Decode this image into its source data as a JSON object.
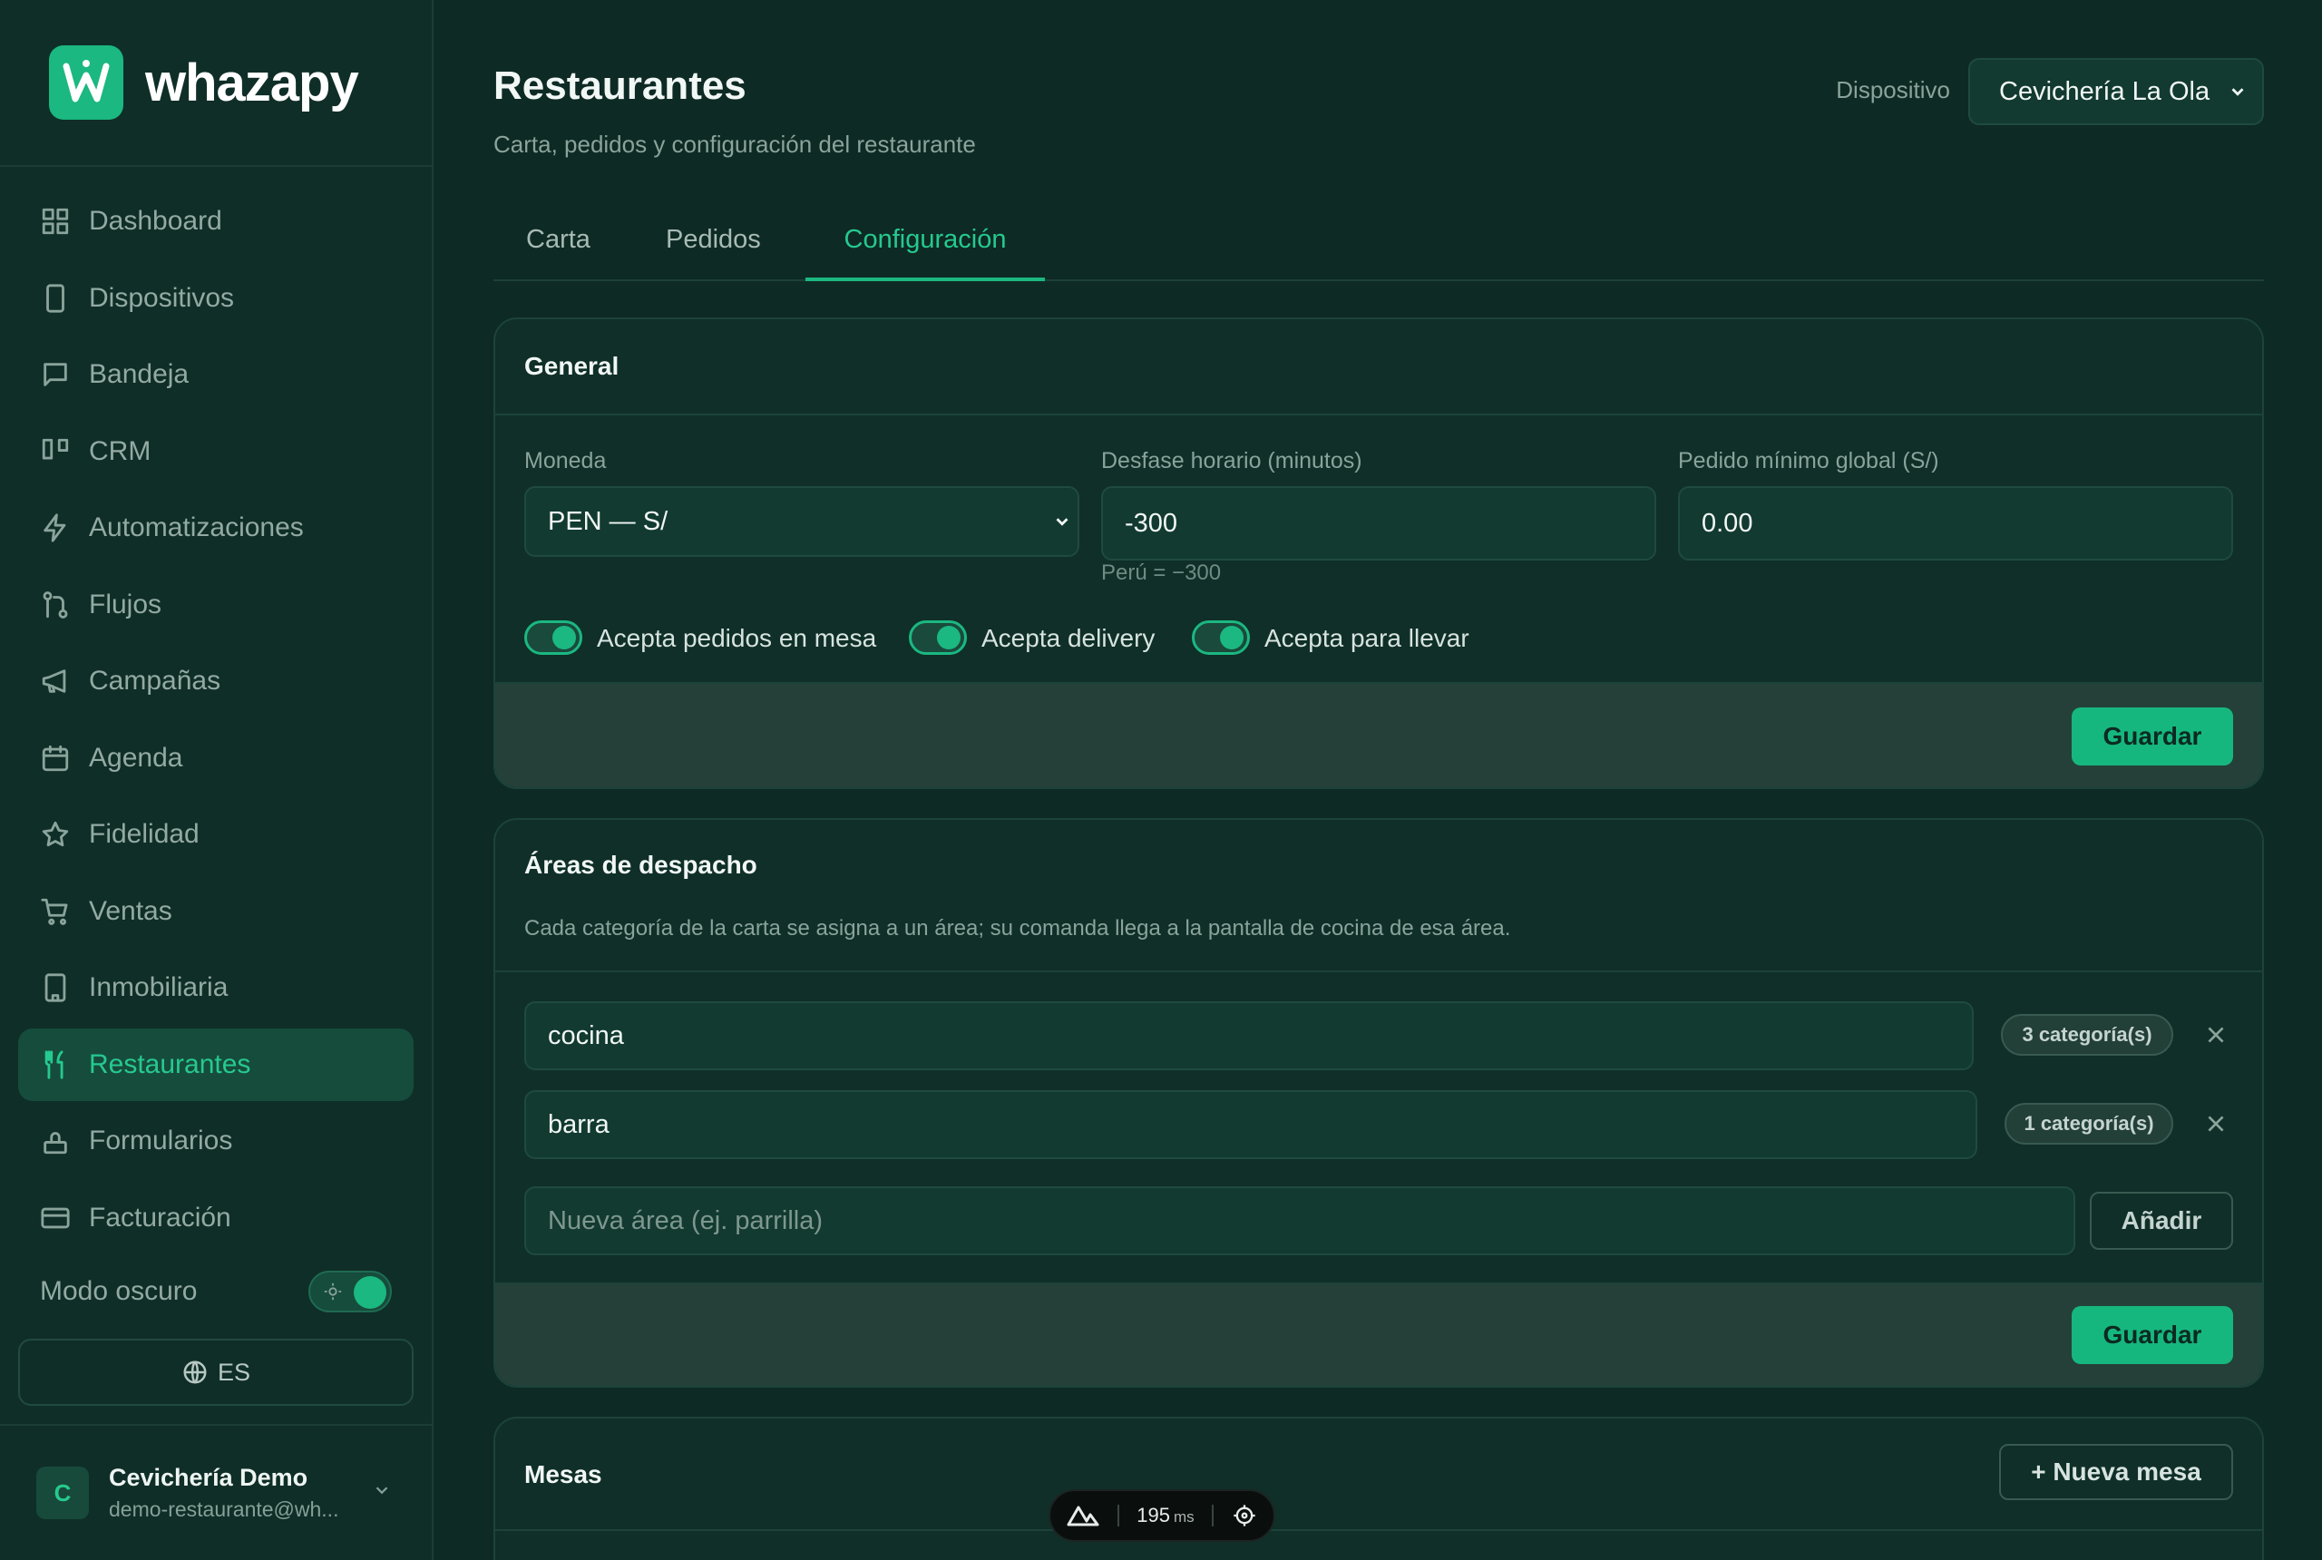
{
  "brand": {
    "name": "whazapy"
  },
  "sidebar": {
    "items": [
      {
        "label": "Dashboard",
        "icon": "dashboard-icon"
      },
      {
        "label": "Dispositivos",
        "icon": "device-icon"
      },
      {
        "label": "Bandeja",
        "icon": "inbox-icon"
      },
      {
        "label": "CRM",
        "icon": "kanban-icon"
      },
      {
        "label": "Automatizaciones",
        "icon": "bolt-icon"
      },
      {
        "label": "Flujos",
        "icon": "flow-icon"
      },
      {
        "label": "Campañas",
        "icon": "megaphone-icon"
      },
      {
        "label": "Agenda",
        "icon": "calendar-icon"
      },
      {
        "label": "Fidelidad",
        "icon": "star-icon"
      },
      {
        "label": "Ventas",
        "icon": "cart-icon"
      },
      {
        "label": "Inmobiliaria",
        "icon": "building-icon"
      },
      {
        "label": "Restaurantes",
        "icon": "utensils-icon",
        "active": true
      },
      {
        "label": "Formularios",
        "icon": "form-icon"
      },
      {
        "label": "Facturación",
        "icon": "credit-card-icon"
      }
    ],
    "dark_mode_label": "Modo oscuro",
    "dark_mode_on": true,
    "language": "ES",
    "user": {
      "initial": "C",
      "name": "Cevichería Demo",
      "email": "demo-restaurante@wh..."
    }
  },
  "header": {
    "title": "Restaurantes",
    "subtitle": "Carta, pedidos y configuración del restaurante",
    "device_label": "Dispositivo",
    "device_selected": "Cevichería La Ola"
  },
  "tabs": [
    {
      "label": "Carta"
    },
    {
      "label": "Pedidos"
    },
    {
      "label": "Configuración",
      "active": true
    }
  ],
  "general": {
    "title": "General",
    "currency_label": "Moneda",
    "currency_value": "PEN — S/",
    "offset_label": "Desfase horario (minutos)",
    "offset_value": "-300",
    "offset_hint": "Perú = −300",
    "min_order_label": "Pedido mínimo global (S/)",
    "min_order_value": "0.00",
    "toggles": [
      {
        "label": "Acepta pedidos en mesa",
        "on": true
      },
      {
        "label": "Acepta delivery",
        "on": true
      },
      {
        "label": "Acepta para llevar",
        "on": true
      }
    ],
    "save_label": "Guardar"
  },
  "areas": {
    "title": "Áreas de despacho",
    "description": "Cada categoría de la carta se asigna a un área; su comanda llega a la pantalla de cocina de esa área.",
    "rows": [
      {
        "name": "cocina",
        "badge": "3 categoría(s)"
      },
      {
        "name": "barra",
        "badge": "1 categoría(s)"
      }
    ],
    "new_placeholder": "Nueva área (ej. parrilla)",
    "add_label": "Añadir",
    "save_label": "Guardar"
  },
  "mesas": {
    "title": "Mesas",
    "new_label": "+ Nueva mesa"
  },
  "perf": {
    "value": "195",
    "unit": "ms"
  },
  "colors": {
    "accent": "#1bb881",
    "background": "#0e2a24",
    "sidebar": "#0f2e27"
  }
}
